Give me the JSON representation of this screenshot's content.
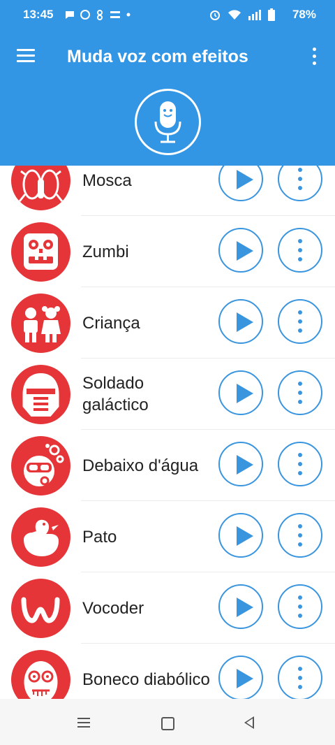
{
  "status_bar": {
    "time": "13:45",
    "battery": "78%"
  },
  "app_bar": {
    "title": "Muda voz com efeitos"
  },
  "colors": {
    "primary": "#3396e4",
    "accent_red": "#e53538",
    "button_blue": "#3a95df"
  },
  "effects": [
    {
      "label": "Mosca",
      "icon": "fly-icon"
    },
    {
      "label": "Zumbi",
      "icon": "zombie-icon"
    },
    {
      "label": "Criança",
      "icon": "children-icon"
    },
    {
      "label": "Soldado galáctico",
      "icon": "galactic-soldier-icon"
    },
    {
      "label": "Debaixo d'água",
      "icon": "diver-icon"
    },
    {
      "label": "Pato",
      "icon": "duck-icon"
    },
    {
      "label": "Vocoder",
      "icon": "vocoder-icon"
    },
    {
      "label": "Boneco diabólico",
      "icon": "evil-puppet-icon"
    }
  ]
}
